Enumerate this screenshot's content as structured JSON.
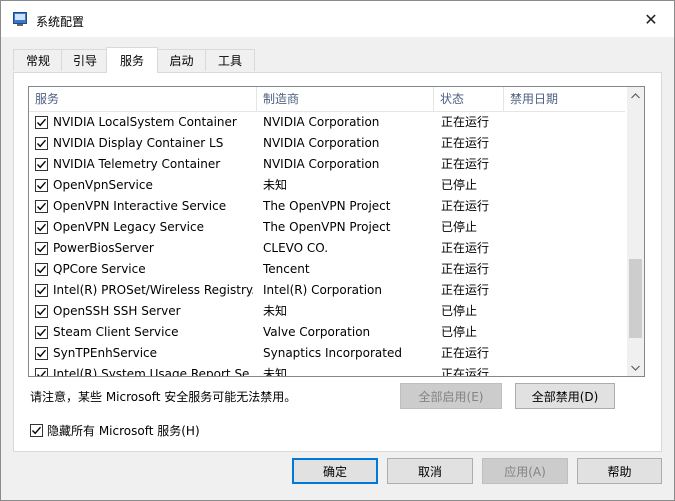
{
  "window": {
    "title": "系统配置",
    "close_glyph": "✕"
  },
  "tabs": [
    {
      "label": "常规"
    },
    {
      "label": "引导"
    },
    {
      "label": "服务",
      "active": true
    },
    {
      "label": "启动"
    },
    {
      "label": "工具"
    }
  ],
  "services": {
    "columns": [
      "服务",
      "制造商",
      "状态",
      "禁用日期"
    ],
    "rows": [
      {
        "name": "NVIDIA LocalSystem Container",
        "vendor": "NVIDIA Corporation",
        "status": "正在运行",
        "date": "",
        "checked": true
      },
      {
        "name": "NVIDIA Display Container LS",
        "vendor": "NVIDIA Corporation",
        "status": "正在运行",
        "date": "",
        "checked": true
      },
      {
        "name": "NVIDIA Telemetry Container",
        "vendor": "NVIDIA Corporation",
        "status": "正在运行",
        "date": "",
        "checked": true
      },
      {
        "name": "OpenVpnService",
        "vendor": "未知",
        "status": "已停止",
        "date": "",
        "checked": true
      },
      {
        "name": "OpenVPN Interactive Service",
        "vendor": "The OpenVPN Project",
        "status": "正在运行",
        "date": "",
        "checked": true
      },
      {
        "name": "OpenVPN Legacy Service",
        "vendor": "The OpenVPN Project",
        "status": "已停止",
        "date": "",
        "checked": true
      },
      {
        "name": "PowerBiosServer",
        "vendor": "CLEVO CO.",
        "status": "正在运行",
        "date": "",
        "checked": true
      },
      {
        "name": "QPCore Service",
        "vendor": "Tencent",
        "status": "正在运行",
        "date": "",
        "checked": true
      },
      {
        "name": "Intel(R) PROSet/Wireless Registry...",
        "vendor": "Intel(R) Corporation",
        "status": "正在运行",
        "date": "",
        "checked": true
      },
      {
        "name": "OpenSSH SSH Server",
        "vendor": "未知",
        "status": "已停止",
        "date": "",
        "checked": true
      },
      {
        "name": "Steam Client Service",
        "vendor": "Valve Corporation",
        "status": "已停止",
        "date": "",
        "checked": true
      },
      {
        "name": "SynTPEnhService",
        "vendor": "Synaptics Incorporated",
        "status": "正在运行",
        "date": "",
        "checked": true
      },
      {
        "name": "Intel(R) System Usage Report Se...",
        "vendor": "未知",
        "status": "正在运行",
        "date": "",
        "checked": true
      }
    ]
  },
  "note": "请注意，某些 Microsoft 安全服务可能无法禁用。",
  "buttons": {
    "enable_all": "全部启用(E)",
    "disable_all": "全部禁用(D)",
    "ok": "确定",
    "cancel": "取消",
    "apply": "应用(A)",
    "help": "帮助"
  },
  "hide_ms_label": "隐藏所有 Microsoft 服务(H)",
  "hide_ms_checked": true,
  "icons": {
    "app": "system-config-icon",
    "close": "close-icon",
    "scroll_up": "chevron-up-icon",
    "scroll_down": "chevron-down-icon",
    "check": "checkmark-icon"
  },
  "colors": {
    "accent": "#0078d7",
    "header_text": "#4d6082"
  }
}
